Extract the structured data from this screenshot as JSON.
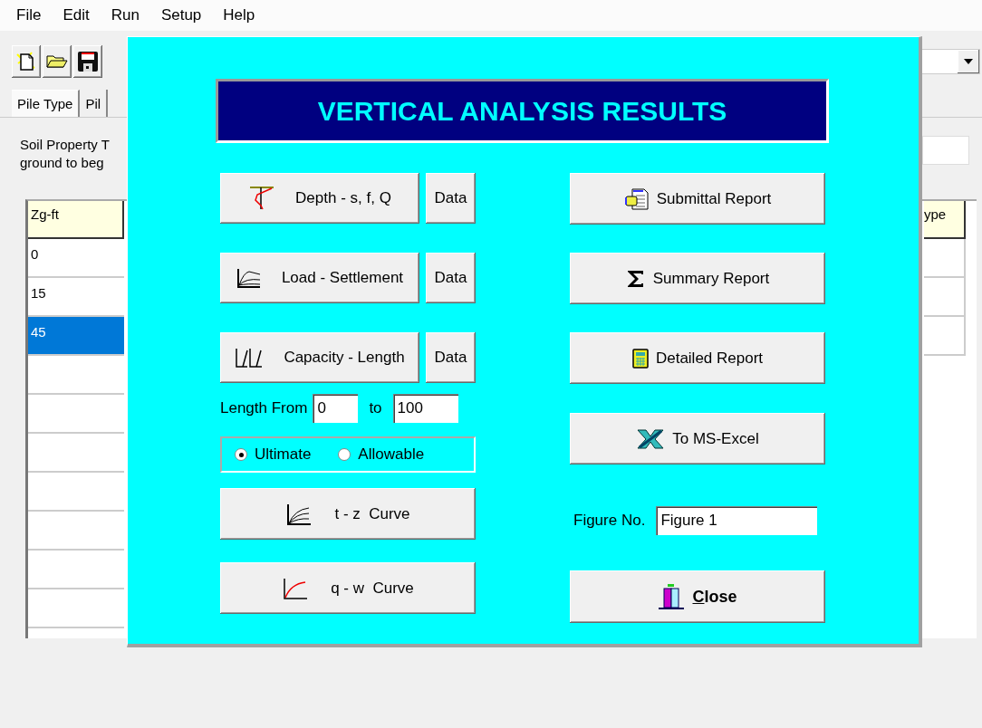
{
  "menu": [
    "File",
    "Edit",
    "Run",
    "Setup",
    "Help"
  ],
  "toolbar": [
    {
      "kind": "new"
    },
    {
      "kind": "open"
    },
    {
      "kind": "save"
    }
  ],
  "tabs": [
    {
      "label": "Pile Type",
      "selected": true
    },
    {
      "label": "Pil",
      "selected": false
    }
  ],
  "note": "Soil Property T\nground to beg",
  "table": {
    "columns": [
      "Zg-ft",
      "ype"
    ],
    "rows": [
      {
        "cells": [
          "0"
        ],
        "selected": false
      },
      {
        "cells": [
          "15"
        ],
        "selected": false
      },
      {
        "cells": [
          "45"
        ],
        "selected": true
      }
    ]
  },
  "dialog": {
    "title": "VERTICAL ANALYSIS RESULTS",
    "plot_buttons": [
      {
        "kind": "depth",
        "label": "Depth - s, f, Q",
        "data_button": "Data"
      },
      {
        "kind": "load",
        "label": "Load - Settlement",
        "data_button": "Data"
      },
      {
        "kind": "capacity",
        "label": "Capacity - Length",
        "data_button": "Data"
      }
    ],
    "length_range": {
      "label": "Length From",
      "from": "0",
      "to_label": "to",
      "to": "100"
    },
    "capacity_mode": [
      {
        "label": "Ultimate",
        "selected": true
      },
      {
        "label": "Allowable",
        "selected": false
      }
    ],
    "curve_buttons": [
      {
        "kind": "tz",
        "label": "t - z  Curve"
      },
      {
        "kind": "qw",
        "label": "q - w  Curve"
      }
    ],
    "report_buttons": [
      {
        "kind": "submittal",
        "label": "Submittal Report"
      },
      {
        "kind": "summary",
        "label": "Summary Report"
      },
      {
        "kind": "detailed",
        "label": "Detailed Report"
      },
      {
        "kind": "excel",
        "label": "To MS-Excel"
      }
    ],
    "figure": {
      "label": "Figure No.",
      "value": "Figure 1"
    },
    "close_button": {
      "label": "Close"
    }
  }
}
